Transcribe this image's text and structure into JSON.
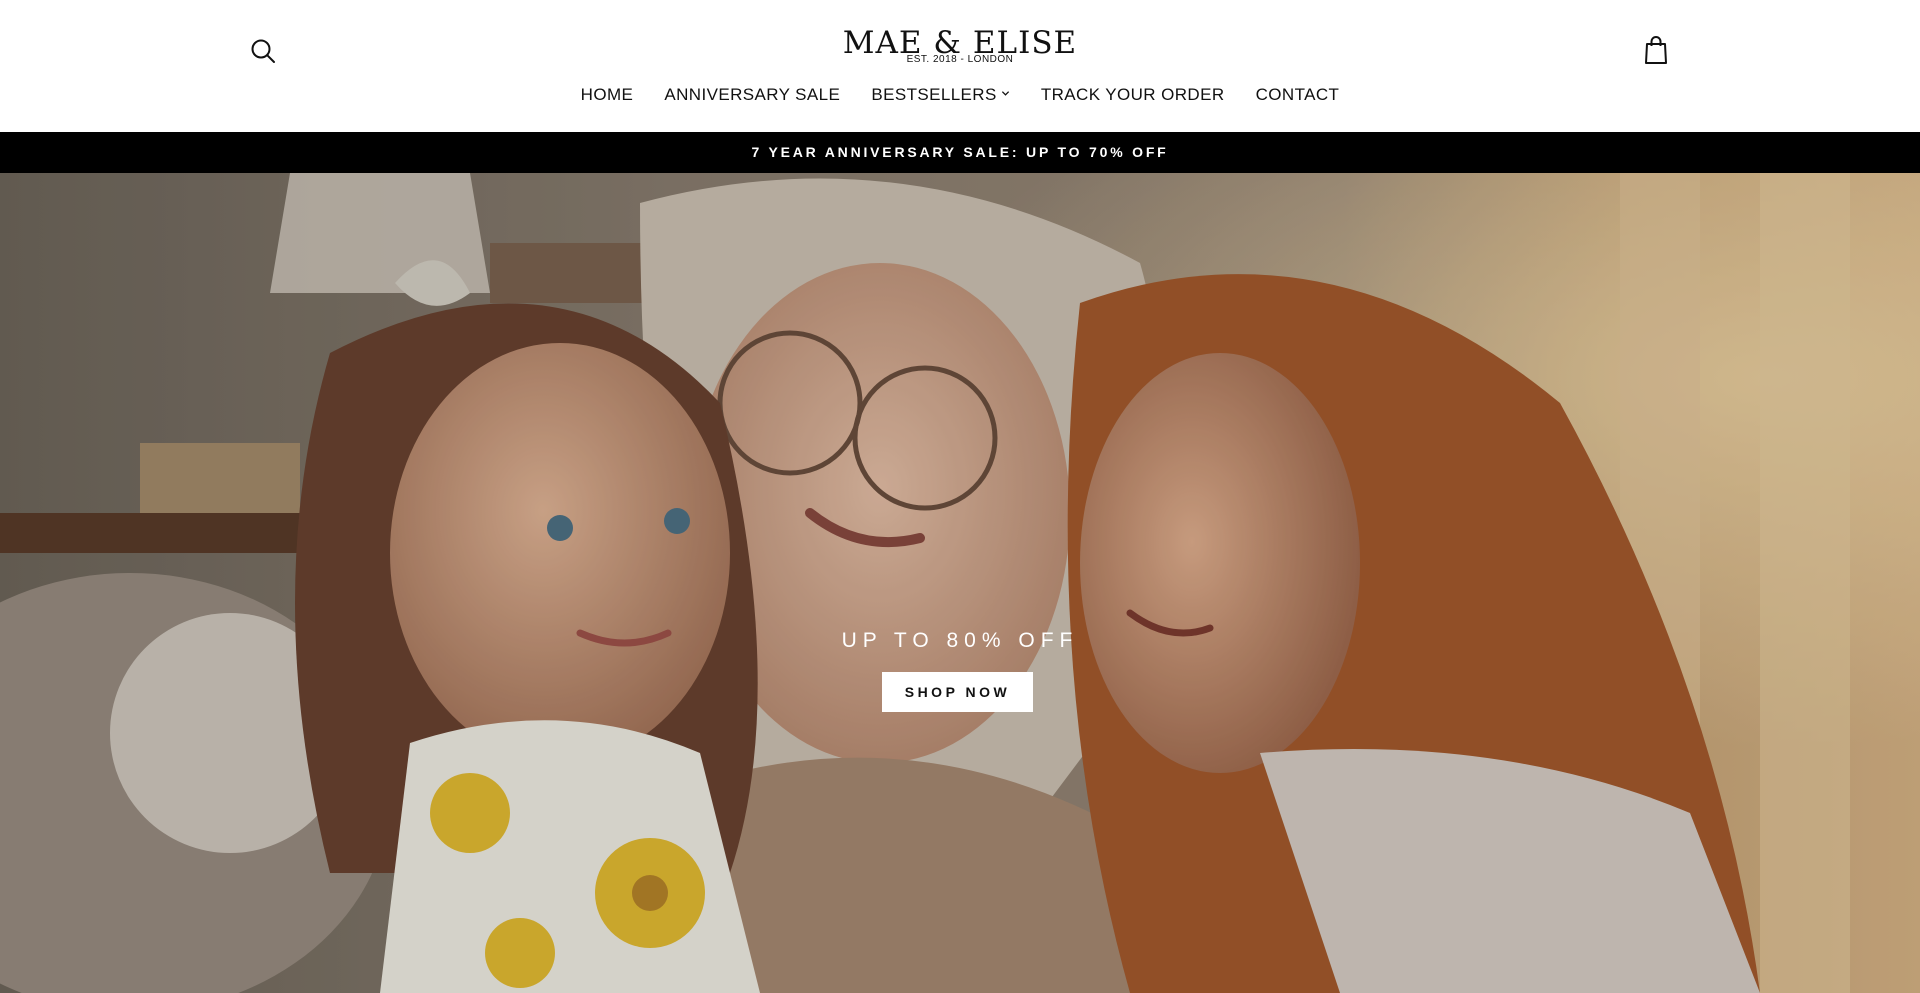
{
  "header": {
    "logo_name": "MAE & ELISE",
    "logo_tagline": "EST. 2018 - LONDON",
    "search_icon": "search-icon",
    "cart_icon": "shopping-bag-icon"
  },
  "nav": {
    "items": [
      {
        "label": "HOME"
      },
      {
        "label": "ANNIVERSARY SALE"
      },
      {
        "label": "BESTSELLERS",
        "has_dropdown": true
      },
      {
        "label": "TRACK YOUR ORDER"
      },
      {
        "label": "CONTACT"
      }
    ]
  },
  "announcement": {
    "text": "7 YEAR ANNIVERSARY SALE: UP TO 70% OFF",
    "background": "#000000",
    "color": "#ffffff"
  },
  "hero": {
    "heading": "UP TO 80% OFF",
    "button_label": "SHOP NOW",
    "image": "photo-of-grandmother-mother-and-little-girl-smiling-together"
  }
}
